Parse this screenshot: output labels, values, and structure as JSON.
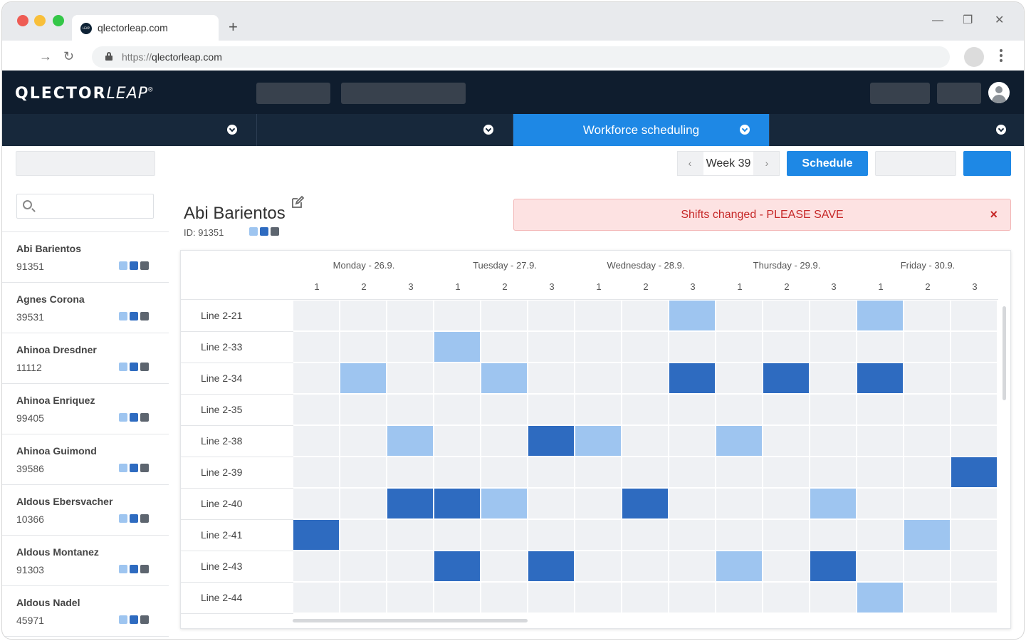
{
  "browser": {
    "tab_title": "qlectorleap.com",
    "favicon_text": "LEAP",
    "new_tab": "+",
    "url_scheme": "https://",
    "url_host": "qlectorleap.com",
    "minimize": "—",
    "restore": "❐",
    "close": "✕",
    "back": "←",
    "forward": "→",
    "reload": "↻"
  },
  "app": {
    "logo_bold": "QLECTOR",
    "logo_italic": "LEAP",
    "logo_reg": "®"
  },
  "modules": {
    "active_label": "Workforce scheduling"
  },
  "toolbar": {
    "week_label": "Week 39",
    "prev": "‹",
    "next": "›",
    "schedule_label": "Schedule"
  },
  "search": {
    "placeholder": ""
  },
  "employees": [
    {
      "name": "Abi Barientos",
      "id": "91351"
    },
    {
      "name": "Agnes Corona",
      "id": "39531"
    },
    {
      "name": "Ahinoa Dresdner",
      "id": "11112"
    },
    {
      "name": "Ahinoa Enriquez",
      "id": "99405"
    },
    {
      "name": "Ahinoa Guimond",
      "id": "39586"
    },
    {
      "name": "Aldous Ebersvacher",
      "id": "10366"
    },
    {
      "name": "Aldous Montanez",
      "id": "91303"
    },
    {
      "name": "Aldous Nadel",
      "id": "45971"
    }
  ],
  "selected_employee": {
    "name": "Abi Barientos",
    "id_label": "ID: 91351"
  },
  "alert": {
    "message": "Shifts changed - PLEASE SAVE",
    "close": "×"
  },
  "colors": {
    "shift_light": "#9ec5f0",
    "shift_dark": "#2e6bc0",
    "shift_grey": "#5d656f",
    "accent": "#1e88e5",
    "header_bg": "#0f1d2e"
  },
  "schedule": {
    "days": [
      "Monday - 26.9.",
      "Tuesday - 27.9.",
      "Wednesday - 28.9.",
      "Thursday - 29.9.",
      "Friday - 30.9."
    ],
    "shifts": [
      "1",
      "2",
      "3"
    ],
    "lines": [
      {
        "label": "Line 2-21",
        "cells": [
          0,
          0,
          0,
          0,
          0,
          0,
          0,
          0,
          1,
          0,
          0,
          0,
          1,
          0,
          0
        ]
      },
      {
        "label": "Line 2-33",
        "cells": [
          0,
          0,
          0,
          1,
          0,
          0,
          0,
          0,
          0,
          0,
          0,
          0,
          0,
          0,
          0
        ]
      },
      {
        "label": "Line 2-34",
        "cells": [
          0,
          1,
          0,
          0,
          1,
          0,
          0,
          0,
          2,
          0,
          2,
          0,
          2,
          0,
          0
        ]
      },
      {
        "label": "Line 2-35",
        "cells": [
          0,
          0,
          0,
          0,
          0,
          0,
          0,
          0,
          0,
          0,
          0,
          0,
          0,
          0,
          0
        ]
      },
      {
        "label": "Line 2-38",
        "cells": [
          0,
          0,
          1,
          0,
          0,
          2,
          1,
          0,
          0,
          1,
          0,
          0,
          0,
          0,
          0
        ]
      },
      {
        "label": "Line 2-39",
        "cells": [
          0,
          0,
          0,
          0,
          0,
          0,
          0,
          0,
          0,
          0,
          0,
          0,
          0,
          0,
          2
        ]
      },
      {
        "label": "Line 2-40",
        "cells": [
          0,
          0,
          2,
          2,
          1,
          0,
          0,
          2,
          0,
          0,
          0,
          1,
          0,
          0,
          0
        ]
      },
      {
        "label": "Line 2-41",
        "cells": [
          2,
          0,
          0,
          0,
          0,
          0,
          0,
          0,
          0,
          0,
          0,
          0,
          0,
          1,
          0
        ]
      },
      {
        "label": "Line 2-43",
        "cells": [
          0,
          0,
          0,
          2,
          0,
          2,
          0,
          0,
          0,
          1,
          0,
          2,
          0,
          0,
          0
        ]
      },
      {
        "label": "Line 2-44",
        "cells": [
          0,
          0,
          0,
          0,
          0,
          0,
          0,
          0,
          0,
          0,
          0,
          0,
          1,
          0,
          0
        ]
      }
    ]
  }
}
